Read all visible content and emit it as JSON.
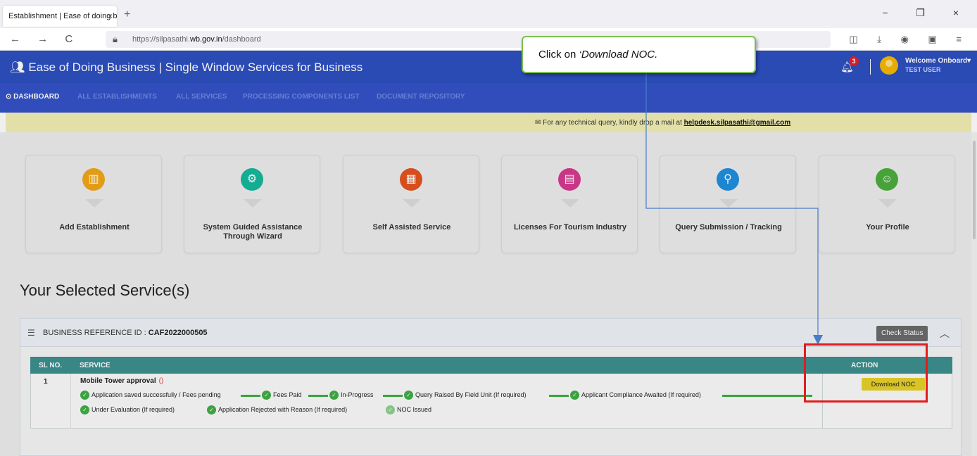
{
  "browser": {
    "tab_title": "Establishment | Ease of doing busin",
    "tab_close": "×",
    "new_tab": "+",
    "nav_buttons": "← → C",
    "url_prefix": "https://silpasathi.",
    "url_domain": "wb.gov.in",
    "url_path": "/dashboard",
    "window_controls": "− ❐ ×",
    "toolbar_icons": "◫ ⤓ ◉ ▣ ≡"
  },
  "header": {
    "title": "Ease of Doing Business | Single Window Services for Business",
    "notification_count": "3",
    "welcome": "Welcome Onboard",
    "user": "TEST USER",
    "colors": {
      "header_bg": "#2d4fc0",
      "nav_bg": "#3552c8"
    }
  },
  "nav": {
    "active": "DASHBOARD",
    "items": [
      "ALL ESTABLISHMENTS",
      "ALL SERVICES",
      "PROCESSING COMPONENTS LIST",
      "DOCUMENT REPOSITORY"
    ]
  },
  "info_bar": {
    "text": "For any technical query, kindly drop a mail at ",
    "email": "helpdesk.silpasathi@gmail.com"
  },
  "tiles": [
    {
      "label": "Add Establishment",
      "icon": "building-icon",
      "color": "#f2a618"
    },
    {
      "label": "System Guided Assistance Through Wizard",
      "icon": "gear-icon",
      "color": "#16b79c"
    },
    {
      "label": "Self Assisted Service",
      "icon": "grid-check-icon",
      "color": "#e3531e"
    },
    {
      "label": "Licenses For Tourism Industry",
      "icon": "license-card-icon",
      "color": "#d63a8f"
    },
    {
      "label": "Query Submission / Tracking",
      "icon": "search-icon",
      "color": "#1f8fe0"
    },
    {
      "label": "Your Profile",
      "icon": "profile-icon",
      "color": "#4cae3d"
    }
  ],
  "section_title": "Your Selected Service(s)",
  "panel": {
    "ref_label": "BUSINESS REFERENCE ID : ",
    "ref_id": "CAF2022000505",
    "check_status": "Check Status",
    "collapse": "︿"
  },
  "table": {
    "headers": {
      "sl": "SL NO.",
      "service": "SERVICE",
      "action": "ACTION"
    },
    "row": {
      "sl": "1",
      "service": "Mobile Tower approval",
      "paren": "()",
      "action": "Download NOC"
    },
    "steps_line1": [
      "Application saved successfully / Fees pending",
      "Fees Paid",
      "In-Progress",
      "Query Raised By Field Unit (If required)",
      "Applicant Compliance Awaited (If required)"
    ],
    "steps_line2": [
      "Under Evaluation (If required)",
      "Application Rejected with Reason (If required)",
      "NOC Issued"
    ]
  },
  "callout": {
    "prefix": "Click on ",
    "emphasis": "‘Download NOC."
  }
}
